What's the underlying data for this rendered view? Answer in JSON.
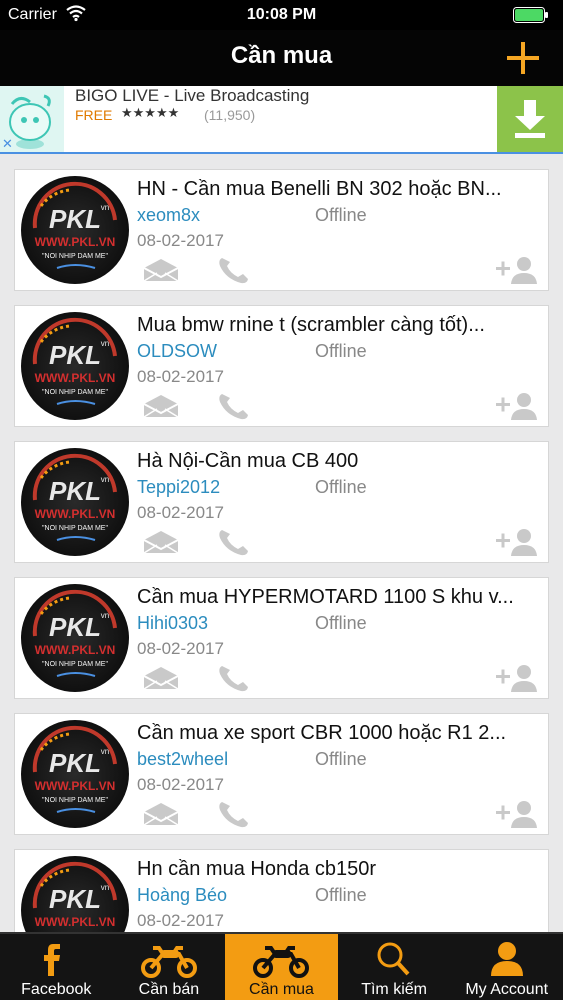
{
  "status_bar": {
    "carrier": "Carrier",
    "time": "10:08 PM"
  },
  "nav": {
    "title": "Cần mua"
  },
  "ad": {
    "title": "BIGO LIVE - Live Broadcasting",
    "price": "FREE",
    "stars": "★★★★★",
    "rating_count": "(11,950)",
    "close_label": "✕",
    "brand_color": "#8cc34a"
  },
  "posts": [
    {
      "title": "HN - Cần mua Benelli BN 302 hoặc BN...",
      "username": "xeom8x",
      "status": "Offline",
      "date": "08-02-2017"
    },
    {
      "title": "Mua bmw rnine t (scrambler càng tốt)...",
      "username": "OLDSOW",
      "status": "Offline",
      "date": "08-02-2017"
    },
    {
      "title": "Hà Nội-Cần mua CB 400",
      "username": "Teppi2012",
      "status": "Offline",
      "date": "08-02-2017"
    },
    {
      "title": "Cần mua HYPERMOTARD 1100 S khu v...",
      "username": "Hihi0303",
      "status": "Offline",
      "date": "08-02-2017"
    },
    {
      "title": "Cần mua xe sport CBR 1000 hoặc R1 2...",
      "username": "best2wheel",
      "status": "Offline",
      "date": "08-02-2017"
    },
    {
      "title": "Hn cần mua Honda cb150r",
      "username": "Hoàng Béo",
      "status": "Offline",
      "date": "08-02-2017"
    }
  ],
  "avatar": {
    "logo": "PKL",
    "logo_sub": "vn",
    "site": "WWW.PKL.VN",
    "slogan": "\"NOI NHIP DAM ME\""
  },
  "tabs": [
    {
      "label": "Facebook",
      "icon": "facebook-icon",
      "active": false
    },
    {
      "label": "Cần bán",
      "icon": "motorbike-icon",
      "active": false
    },
    {
      "label": "Cần mua",
      "icon": "motorbike-icon",
      "active": true
    },
    {
      "label": "Tìm kiếm",
      "icon": "search-icon",
      "active": false
    },
    {
      "label": "My Account",
      "icon": "account-icon",
      "active": false
    }
  ],
  "colors": {
    "accent": "#f39c12",
    "username": "#2b8cbe",
    "nav_bg": "#050505"
  }
}
